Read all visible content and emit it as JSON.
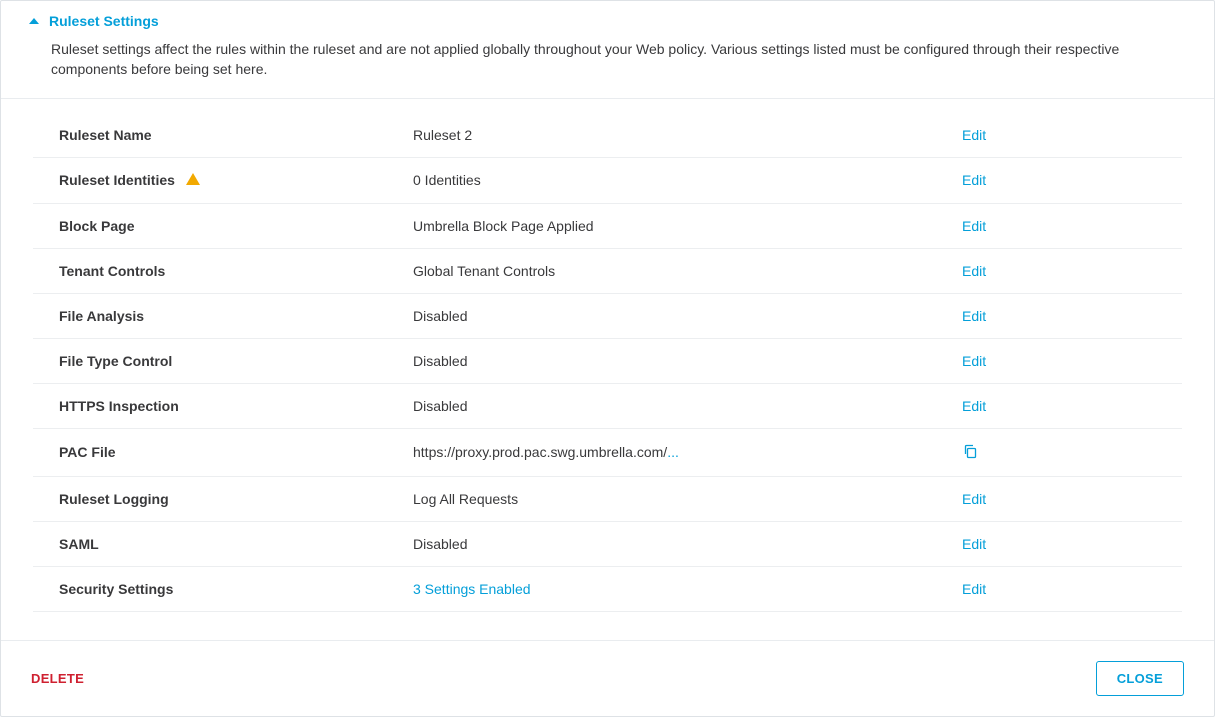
{
  "header": {
    "title": "Ruleset Settings",
    "description": "Ruleset settings affect the rules within the ruleset and are not applied globally throughout your Web policy. Various settings listed must be configured through their respective components before being set here."
  },
  "rows": {
    "name": {
      "label": "Ruleset Name",
      "value": "Ruleset 2",
      "action": "Edit",
      "style": "plain"
    },
    "identities": {
      "label": "Ruleset Identities",
      "value": "0 Identities",
      "action": "Edit",
      "style": "plain",
      "warn": true
    },
    "blockpage": {
      "label": "Block Page",
      "value": "Umbrella Block Page Applied",
      "action": "Edit",
      "style": "plain"
    },
    "tenant": {
      "label": "Tenant Controls",
      "value": "Global Tenant Controls",
      "action": "Edit",
      "style": "plain"
    },
    "fileanalysis": {
      "label": "File Analysis",
      "value": "Disabled",
      "action": "Edit",
      "style": "disabled"
    },
    "filetype": {
      "label": "File Type Control",
      "value": "Disabled",
      "action": "Edit",
      "style": "disabled"
    },
    "https": {
      "label": "HTTPS Inspection",
      "value": "Disabled",
      "action": "Edit",
      "style": "disabled"
    },
    "pac": {
      "label": "PAC File",
      "value": "https://proxy.prod.pac.swg.umbrella.com/",
      "ellipsis": "...",
      "action": "copy",
      "style": "plain"
    },
    "logging": {
      "label": "Ruleset Logging",
      "value": "Log All Requests",
      "action": "Edit",
      "style": "plain"
    },
    "saml": {
      "label": "SAML",
      "value": "Disabled",
      "action": "Edit",
      "style": "disabled"
    },
    "security": {
      "label": "Security Settings",
      "value": "3 Settings Enabled",
      "action": "Edit",
      "style": "link"
    }
  },
  "footer": {
    "delete": "DELETE",
    "close": "CLOSE"
  }
}
